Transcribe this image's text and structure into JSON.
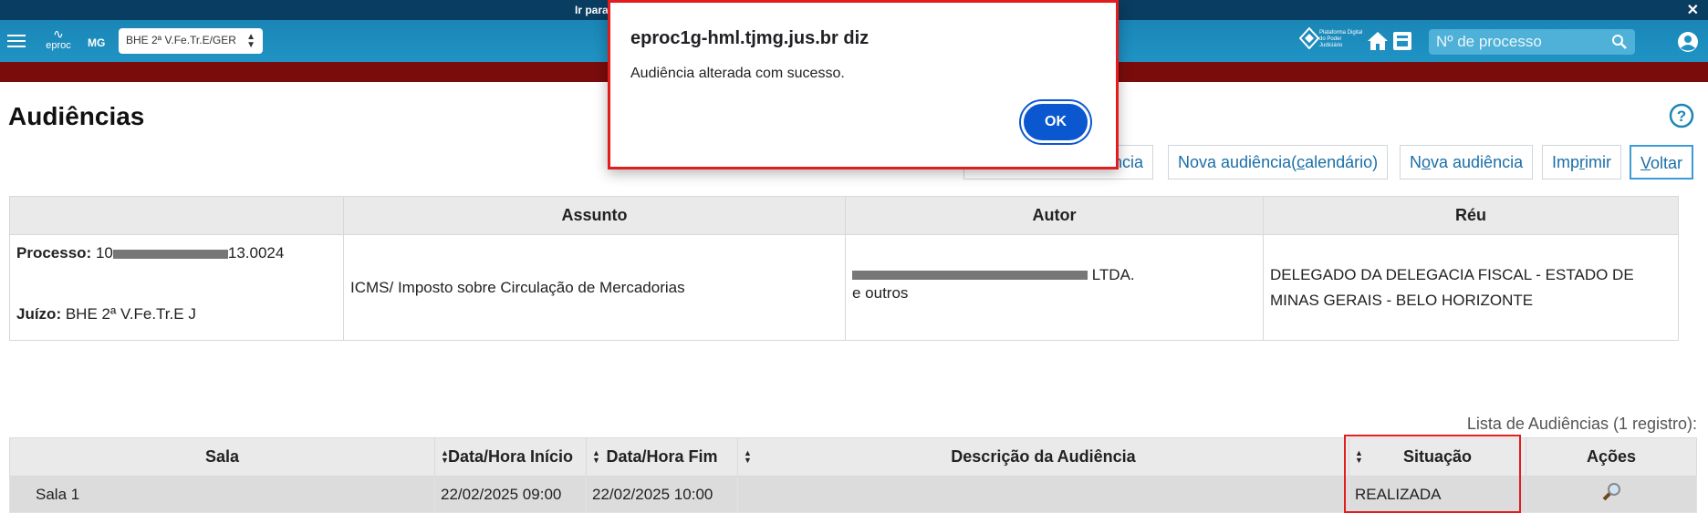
{
  "skipbar": {
    "text": "Ir para",
    "close": "✕"
  },
  "nav": {
    "logo_text": "eproc",
    "state": "MG",
    "org_select_value": "BHE 2ª V.Fe.Tr.E/GER",
    "platform_text": "Plataforma Digital do Poder Judiciário",
    "search_placeholder": "Nº de processo"
  },
  "page": {
    "title": "Audiências",
    "buttons": {
      "nova_sessao": "encia",
      "nova_calendario": {
        "pre": "Nova audiência(",
        "u": "c",
        "post": "alendário)"
      },
      "nova": {
        "pre": "N",
        "u": "o",
        "post": "va audiência"
      },
      "imprimir": {
        "pre": "Imp",
        "u": "r",
        "post": "imir"
      },
      "voltar": {
        "pre": "",
        "u": "V",
        "post": "oltar"
      }
    }
  },
  "info_table": {
    "headers": [
      "",
      "Assunto",
      "Autor",
      "Réu"
    ],
    "processo_label": "Processo:",
    "processo_prefix": "10",
    "processo_suffix": "13.0024",
    "juizo_label": "Juízo:",
    "juizo_value": "BHE 2ª V.Fe.Tr.E J",
    "assunto": "ICMS/ Imposto sobre Circulação de Mercadorias",
    "autor_suffix": "LTDA.",
    "autor_line2": "e outros",
    "reu_line1": "DELEGADO DA DELEGACIA FISCAL - ESTADO DE",
    "reu_line2": "MINAS GERAIS - BELO HORIZONTE"
  },
  "list": {
    "count": "Lista de Audiências (1 registro):",
    "headers": [
      "Sala",
      "Data/Hora Início",
      "Data/Hora Fim",
      "Descrição da Audiência",
      "Situação",
      "Ações"
    ],
    "rows": [
      {
        "sala": "Sala 1",
        "inicio": "22/02/2025 09:00",
        "fim": "22/02/2025 10:00",
        "descricao": "",
        "situacao": "REALIZADA"
      }
    ]
  },
  "dialog": {
    "host": "eproc1g-hml.tjmg.jus.br diz",
    "message": "Audiência alterada com sucesso.",
    "ok": "OK"
  },
  "colors": {
    "nav": "#1f93c4",
    "accent_bar": "#7a0c0c",
    "link": "#1a6fa8",
    "highlight": "#e11d1d",
    "ok_button": "#0b57d0"
  }
}
